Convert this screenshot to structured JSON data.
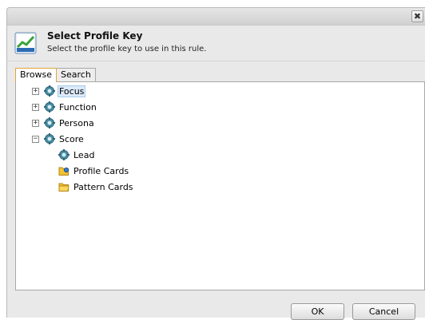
{
  "dialog": {
    "close_glyph": "✖",
    "title": "Select Profile Key",
    "subtitle": "Select the profile key to use in this rule."
  },
  "tabs": [
    {
      "label": "Browse",
      "active": true
    },
    {
      "label": "Search",
      "active": false
    }
  ],
  "tree": [
    {
      "label": "Focus",
      "icon": "gear-icon",
      "expander": "+",
      "selected": true
    },
    {
      "label": "Function",
      "icon": "gear-icon",
      "expander": "+",
      "selected": false
    },
    {
      "label": "Persona",
      "icon": "gear-icon",
      "expander": "+",
      "selected": false
    },
    {
      "label": "Score",
      "icon": "gear-icon",
      "expander": "−",
      "selected": false
    },
    {
      "label": "Lead",
      "icon": "gear-icon",
      "expander": "",
      "selected": false
    },
    {
      "label": "Profile Cards",
      "icon": "folder-icon",
      "expander": "",
      "selected": false
    },
    {
      "label": "Pattern Cards",
      "icon": "folder-icon",
      "expander": "",
      "selected": false
    }
  ],
  "buttons": {
    "ok": "OK",
    "cancel": "Cancel"
  },
  "colors": {
    "selection_bg": "#dbeaf9",
    "active_tab_border": "#e2a53a",
    "gear": "#4a8fa6",
    "folder": "#f2c230"
  }
}
